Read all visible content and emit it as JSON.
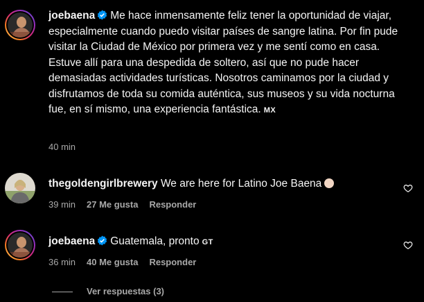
{
  "comments": [
    {
      "username": "joebaena",
      "verified": true,
      "text": "Me hace inmensamente feliz tener la oportunidad de viajar, especialmente cuando puedo visitar países de sangre latina. Por fin pude visitar la Ciudad de México por primera vez y me sentí como en casa. Estuve allí para una despedida de soltero, así que no pude hacer demasiadas actividades turísticas. Nosotros caminamos por la ciudad y disfrutamos de toda su comida auténtica, sus museos y su vida nocturna fue, en sí mismo, una experiencia fantástica.",
      "flag": "MX",
      "time": "40 min"
    },
    {
      "username": "thegoldengirlbrewery",
      "verified": false,
      "text": "We are here for Latino Joe Baena",
      "emoji": "clapping-hands",
      "time": "39 min",
      "likes": "27 Me gusta",
      "reply": "Responder"
    },
    {
      "username": "joebaena",
      "verified": true,
      "text": "Guatemala, pronto",
      "flag": "GT",
      "time": "36 min",
      "likes": "40 Me gusta",
      "reply": "Responder"
    }
  ],
  "view_replies": "Ver respuestas (3)",
  "colors": {
    "background": "#000000",
    "text": "#f5f5f5",
    "muted": "#a8a8a8",
    "verified": "#0095f6"
  }
}
